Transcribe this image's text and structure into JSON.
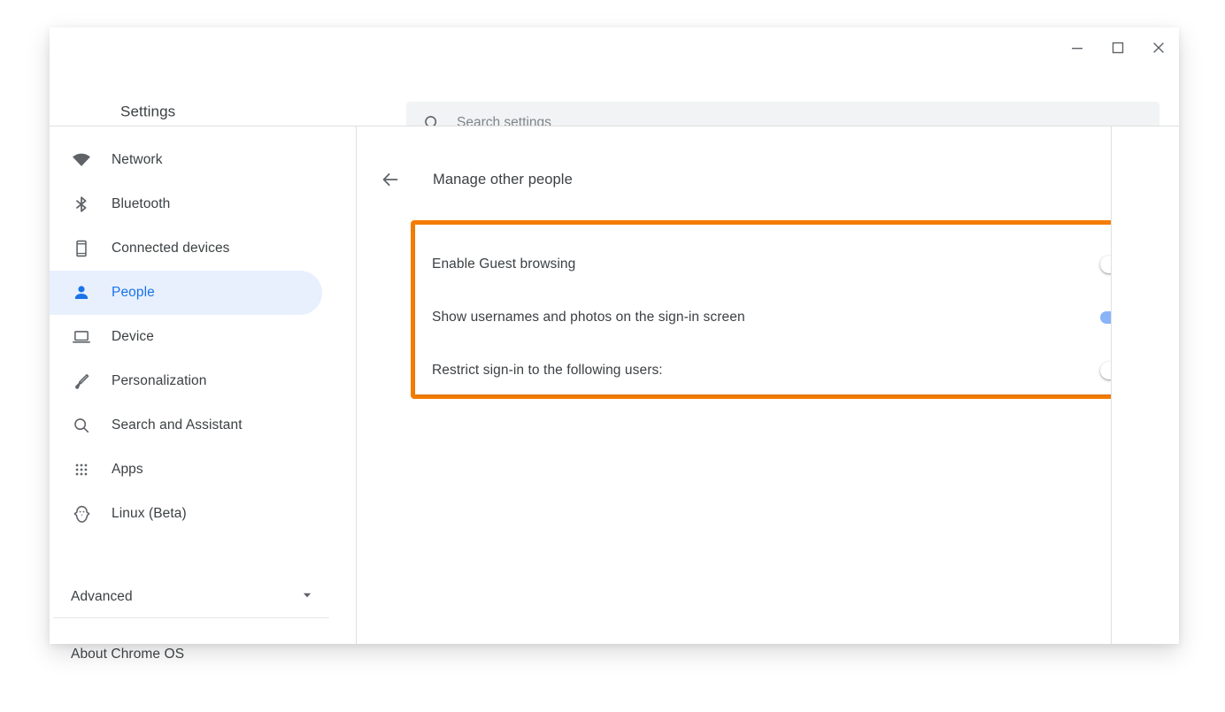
{
  "window": {
    "controls": [
      {
        "name": "minimize",
        "glyph": "minimize-icon"
      },
      {
        "name": "maximize",
        "glyph": "maximize-icon"
      },
      {
        "name": "close",
        "glyph": "close-icon"
      }
    ]
  },
  "header": {
    "app_title": "Settings"
  },
  "search": {
    "placeholder": "Search settings",
    "value": "",
    "icon": "search-icon"
  },
  "sidebar": {
    "items": [
      {
        "label": "Network",
        "icon": "wifi-icon",
        "selected": false
      },
      {
        "label": "Bluetooth",
        "icon": "bluetooth-icon",
        "selected": false
      },
      {
        "label": "Connected devices",
        "icon": "smartphone-icon",
        "selected": false
      },
      {
        "label": "People",
        "icon": "person-icon",
        "selected": true
      },
      {
        "label": "Device",
        "icon": "laptop-icon",
        "selected": false
      },
      {
        "label": "Personalization",
        "icon": "paintbrush-icon",
        "selected": false
      },
      {
        "label": "Search and Assistant",
        "icon": "magnifier-icon",
        "selected": false
      },
      {
        "label": "Apps",
        "icon": "apps-grid-icon",
        "selected": false
      },
      {
        "label": "Linux (Beta)",
        "icon": "penguin-icon",
        "selected": false
      }
    ],
    "advanced": {
      "label": "Advanced",
      "icon": "chevron-down-icon"
    },
    "about": {
      "label": "About Chrome OS"
    }
  },
  "main": {
    "back_icon": "back-arrow-icon",
    "page_title": "Manage other people",
    "highlight_color": "#f57c00",
    "accent_color": "#1a73e8",
    "settings": [
      {
        "label": "Enable Guest browsing",
        "state": "off"
      },
      {
        "label": "Show usernames and photos on the sign-in screen",
        "state": "on"
      },
      {
        "label": "Restrict sign-in to the following users:",
        "state": "off"
      }
    ]
  }
}
